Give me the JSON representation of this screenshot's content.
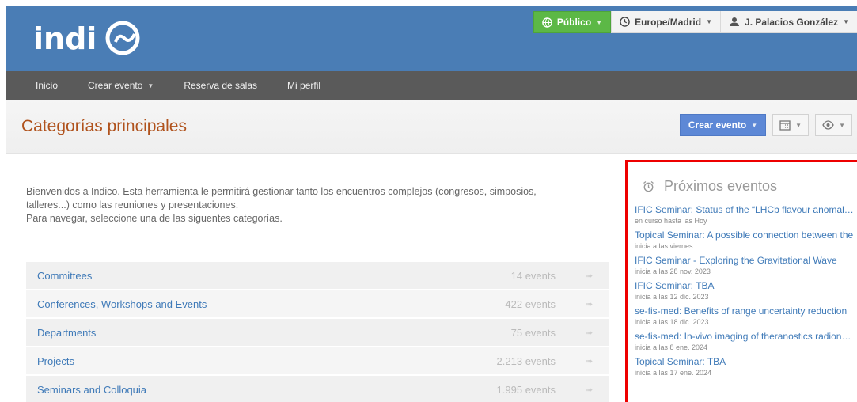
{
  "header": {
    "logo_text": "indico",
    "public_label": "Público",
    "timezone_label": "Europe/Madrid",
    "user_label": "J. Palacios González"
  },
  "nav": {
    "items": [
      {
        "label": "Inicio"
      },
      {
        "label": "Crear evento"
      },
      {
        "label": "Reserva de salas"
      },
      {
        "label": "Mi perfil"
      }
    ]
  },
  "title_bar": {
    "title": "Categorías principales",
    "create_event_label": "Crear evento"
  },
  "welcome": {
    "line1": "Bienvenidos a Indico. Esta herramienta le permitirá gestionar tanto los encuentros complejos (congresos, simposios,",
    "line2": "talleres...) como las reuniones y presentaciones.",
    "line3": "Para navegar, seleccione una de las siguentes categorías."
  },
  "categories": [
    {
      "name": "Committees",
      "count": "14 events"
    },
    {
      "name": "Conferences, Workshops and Events",
      "count": "422 events"
    },
    {
      "name": "Departments",
      "count": "75 events"
    },
    {
      "name": "Projects",
      "count": "2.213 events"
    },
    {
      "name": "Seminars and Colloquia",
      "count": "1.995 events"
    }
  ],
  "upcoming": {
    "title": "Próximos eventos",
    "events": [
      {
        "title": "IFIC Seminar: Status of the “LHCb flavour anomalies”",
        "date": "en curso hasta las Hoy"
      },
      {
        "title": "Topical Seminar: A possible connection between the",
        "date": "inicia a las viernes"
      },
      {
        "title": "IFIC Seminar - Exploring the Gravitational Wave",
        "date": "inicia a las 28 nov. 2023"
      },
      {
        "title": "IFIC Seminar: TBA",
        "date": "inicia a las 12 dic. 2023"
      },
      {
        "title": "se-fis-med: Benefits of range uncertainty reduction",
        "date": "inicia a las 18 dic. 2023"
      },
      {
        "title": "se-fis-med: In-vivo imaging of theranostics radionuclides",
        "date": "inicia a las 8 ene. 2024"
      },
      {
        "title": "Topical Seminar: TBA",
        "date": "inicia a las 17 ene. 2024"
      }
    ]
  },
  "colors": {
    "header_blue": "#4a7db5",
    "nav_gray": "#5a5a5a",
    "public_green": "#5cb846",
    "title_orange": "#b0521c",
    "link_blue": "#3f7ab8",
    "highlight_red": "#ee0000"
  }
}
